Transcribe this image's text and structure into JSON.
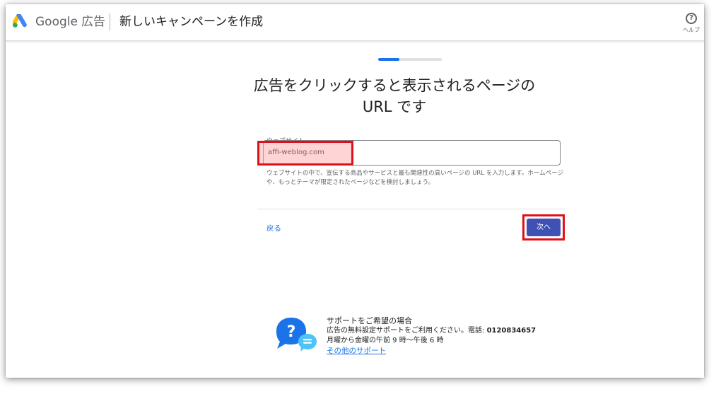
{
  "header": {
    "brand_google": "Google",
    "brand_ads": "広告",
    "page_title": "新しいキャンペーンを作成",
    "help_label": "ヘルプ"
  },
  "progress": {
    "fraction": 0.33
  },
  "main": {
    "title": "広告をクリックすると表示されるページの URL です",
    "website_label": "ウェブサイト",
    "website_value": "affi-weblog.com",
    "help_text": "ウェブサイトの中で、宣伝する商品やサービスと最も関連性の高いページの URL を入力します。ホームページや、もっとテーマが限定されたページなどを検討しましょう。",
    "back_label": "戻る",
    "next_label": "次へ"
  },
  "support": {
    "title": "サポートをご希望の場合",
    "line1_prefix": "広告の無料設定サポートをご利用ください。電話: ",
    "phone": "0120834657",
    "hours": "月曜から金曜の午前 9 時〜午後 6 時",
    "other_link": "その他のサポート"
  },
  "colors": {
    "accent_blue": "#1a73e8",
    "next_button": "#3f51b5",
    "highlight_red": "#e0101a"
  }
}
